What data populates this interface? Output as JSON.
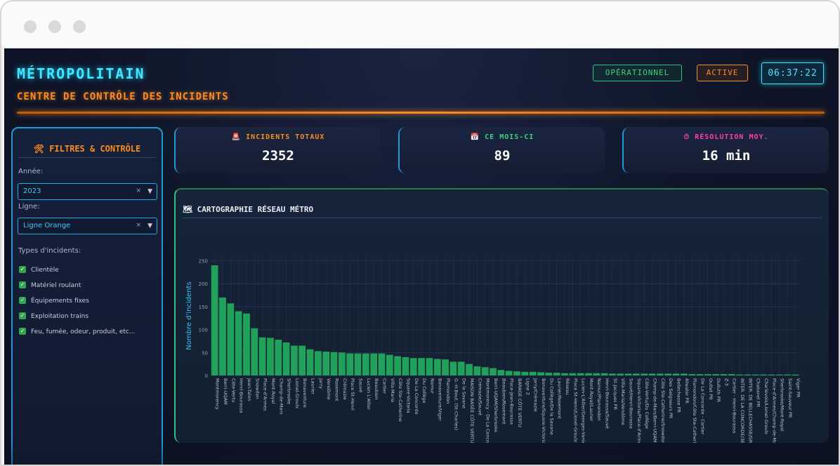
{
  "app": {
    "title": "MÉTROPOLITAIN",
    "subtitle": "CENTRE DE CONTRÔLE DES INCIDENTS",
    "status_operational": "OPÉRATIONNEL",
    "status_active": "ACTIVE",
    "clock": "06:37:22"
  },
  "sidebar": {
    "heading": "🛠 FILTRES & CONTRÔLE",
    "year_label": "Année:",
    "year_value": "2023",
    "line_label": "Ligne:",
    "line_value": "Ligne Orange",
    "clear_symbol": "×",
    "types_label": "Types d'incidents:",
    "types": [
      {
        "label": "Clientèle",
        "checked": true
      },
      {
        "label": "Matériel roulant",
        "checked": true
      },
      {
        "label": "Équipements fixes",
        "checked": true
      },
      {
        "label": "Exploitation trains",
        "checked": true
      },
      {
        "label": "Feu, fumée, odeur, produit, etc...",
        "checked": true
      }
    ]
  },
  "kpis": [
    {
      "title": "🚨 INCIDENTS TOTAUX",
      "value": "2352",
      "color": "#ff8c1a"
    },
    {
      "title": "📅 CE MOIS-CI",
      "value": "89",
      "color": "#35d67f"
    },
    {
      "title": "⏱ RÉSOLUTION MOY.",
      "value": "16 min",
      "color": "#ff3fa6"
    }
  ],
  "colors": {
    "accent_cyan": "#3ee8ff",
    "accent_orange": "#ff8c1a",
    "bar_green": "#1fa35a",
    "background": "#0e1527"
  },
  "chart_data": {
    "type": "bar",
    "title": "🗺 CARTOGRAPHIE RÉSEAU MÉTRO",
    "ylabel": "Nombre d'incidents",
    "xlabel": "",
    "ylim": [
      0,
      260
    ],
    "yticks": [
      0,
      50,
      100,
      150,
      200,
      250
    ],
    "grid": true,
    "categories": [
      "Montmorency",
      "Berri-UQAM",
      "Côte-Vertu",
      "Henri-Bourassa",
      "Jean-Talon",
      "Snowdon",
      "Place-d'Armes",
      "Mont-Royal",
      "Champ-de-Mars",
      "Sherbrooke",
      "Lionel-Groulx",
      "Bonaventure",
      "Laurier",
      "Jarry",
      "Vendôme",
      "Rosemont",
      "Crémazie",
      "Place St-Henri",
      "Sauvé",
      "Lucien L'Allier",
      "Beaubien",
      "Cartier",
      "Villa-Maria",
      "Côte Ste-Catherine",
      "Square-Victoria",
      "De La Concorde",
      "Du Collège",
      "Namur",
      "Bonaventure/Viger",
      "Plamondon",
      "G.-H.Bout. (St-Charles)",
      "De la Savane",
      "MAISON BASÉE CÔTE VERTU",
      "Crémazie/Sauvé",
      "Montmorency - De La Concorde",
      "Berri-UQAM/Sherbrooke",
      "Beaubien/Rosemont",
      "Place-Jean-Bourassa",
      "BARAGE CÔTE VERTU",
      "Ligne 2",
      "Jarry/Crémazie",
      "Bonaventure/Square-Victoria",
      "Du Collège/De la Savane",
      "Laurier/Rosemont",
      "Réseau",
      "Place St-Henri/Lionel-Groulx",
      "Lucien-L'Allier/Georges-Vanier",
      "Mont-Royal/Laurier",
      "Namur/Plamondon",
      "Henri-Bourassa/Sauvé",
      "St-Jacques PR",
      "Villa-Maria/Vendôme",
      "Sauvé/Henri-Bourassa",
      "Square-Victoria/Place-d'Armes",
      "Côte-Vertu/Du Collège",
      "Champ-de-Mars/Berri-UQAM",
      "Côte Ste-Catherine/Snowdon",
      "Des Seigneurs PR",
      "Bellechasse PR",
      "Atwater PR",
      "Plamondon/Côte Ste-Catherine",
      "De La Concorde - Cartier",
      "Outlet PR",
      "Dulluth PR",
      "Z-3",
      "Cartier - Henri-Bourassa",
      "INTER. DE LA CONCORDE/3BB",
      "INTER. DE BELLECHASSE/GRAC",
      "Chabanel PR",
      "Charlevoix/Lionel-Groulx",
      "Place-d'Armes/Champ-de-Mars",
      "Sherbrooke/Mont-Royal",
      "Saint-Sauveur PR",
      "Viger PR"
    ],
    "series": [
      {
        "values": [
          240,
          170,
          157,
          140,
          135,
          103,
          83,
          82,
          78,
          72,
          65,
          65,
          57,
          53,
          52,
          51,
          50,
          48,
          48,
          48,
          48,
          48,
          45,
          42,
          40,
          38,
          38,
          38,
          36,
          35,
          30,
          30,
          25,
          20,
          18,
          16,
          12,
          10,
          9,
          8,
          8,
          7,
          6,
          6,
          5,
          5,
          5,
          5,
          5,
          5,
          4,
          4,
          4,
          4,
          4,
          4,
          4,
          4,
          4,
          4,
          3,
          3,
          3,
          3,
          3,
          3,
          2,
          2,
          2,
          2,
          2,
          2,
          2,
          2
        ]
      }
    ]
  }
}
